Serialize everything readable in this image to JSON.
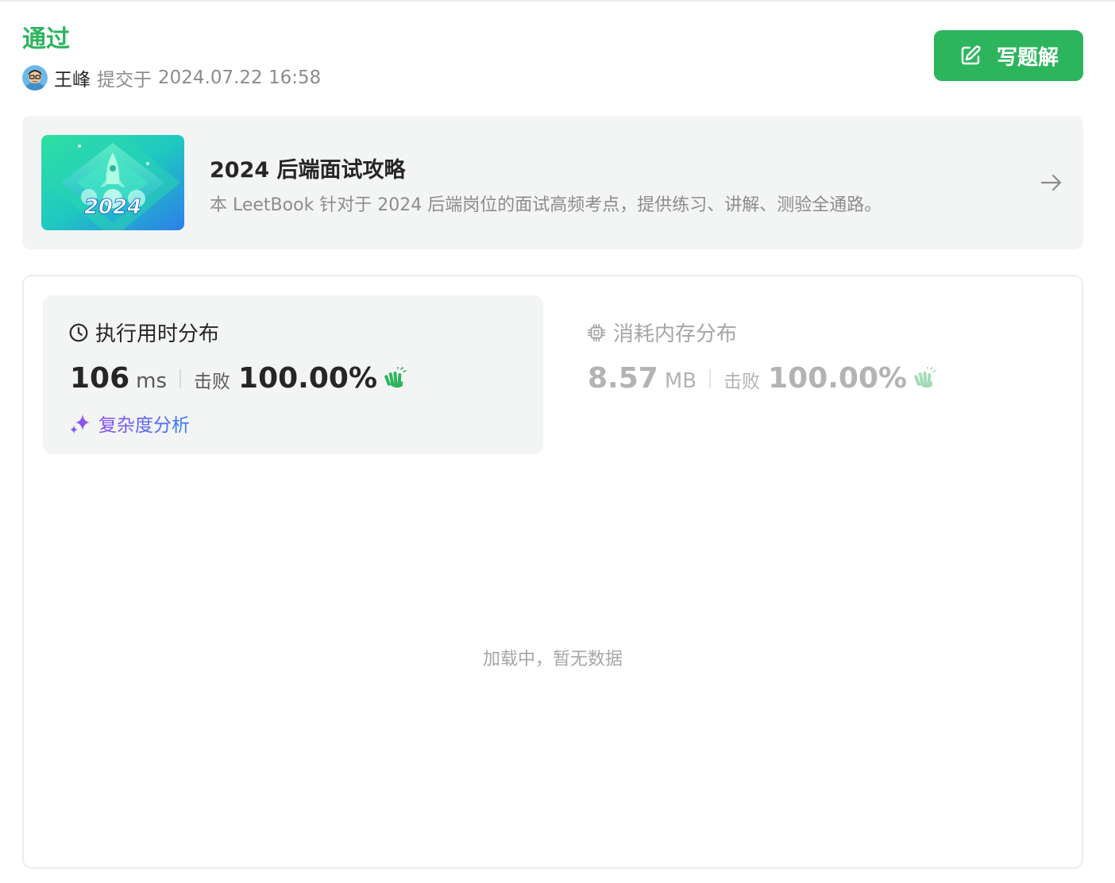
{
  "submission": {
    "status": "通过",
    "user_name": "王峰",
    "submit_prefix": "提交于",
    "submit_time": "2024.07.22 16:58"
  },
  "actions": {
    "write_solution_label": "写题解",
    "write_solution_icon": "edit-icon"
  },
  "leetbook": {
    "cover_text": "2024",
    "title": "2024 后端面试攻略",
    "description": "本 LeetBook 针对于 2024 后端岗位的面试高频考点，提供练习、讲解、测验全通路。",
    "arrow_icon": "arrow-right-icon"
  },
  "runtime": {
    "title": "执行用时分布",
    "icon": "clock-icon",
    "value": "106",
    "unit": "ms",
    "beat_label": "击败",
    "beat_value": "100.00%",
    "complexity_label": "复杂度分析"
  },
  "memory": {
    "title": "消耗内存分布",
    "icon": "chip-icon",
    "value": "8.57",
    "unit": "MB",
    "beat_label": "击败",
    "beat_value": "100.00%"
  },
  "chart": {
    "empty_text": "加载中，暂无数据"
  },
  "colors": {
    "accent_green": "#2db55d",
    "card_bg": "#f3f4f4",
    "muted_text": "#8c8c8c"
  }
}
